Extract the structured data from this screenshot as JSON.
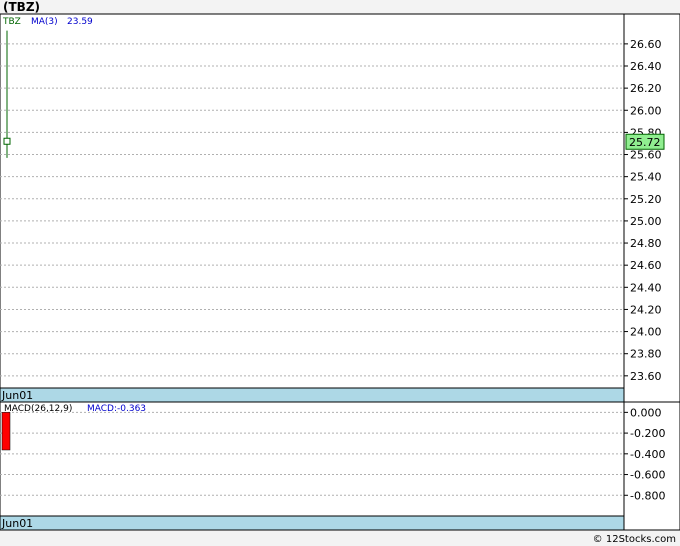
{
  "title": "(TBZ)",
  "footer": "© 12Stocks.com",
  "colors": {
    "background": "#ffffff",
    "grid": "#b0b0b0",
    "axis_band": "#add8e6",
    "price_line": "#006400",
    "last_price_box": "#90ee90",
    "macd_bar": "#ff0000",
    "ma_legend": "#0000cd"
  },
  "chart_data": [
    {
      "type": "line",
      "legend": {
        "ticker": "TBZ",
        "ma_label": "MA(3)",
        "ma_value": "23.59"
      },
      "x": [
        "Jun01"
      ],
      "xlabel_band": "Jun01",
      "yticks": [
        "26.60",
        "26.40",
        "26.20",
        "26.00",
        "25.80",
        "25.60",
        "25.40",
        "25.20",
        "25.00",
        "24.80",
        "24.60",
        "24.40",
        "24.20",
        "24.00",
        "23.80",
        "23.60"
      ],
      "ylim": [
        23.49,
        26.87
      ],
      "series": [
        {
          "name": "TBZ",
          "high": 26.72,
          "low": 25.57,
          "open": 25.72,
          "close": 25.72
        }
      ],
      "last_price": "25.72",
      "grid": true
    },
    {
      "type": "bar",
      "legend": {
        "name": "MACD(26,12,9)",
        "value_label": "MACD:-0.363"
      },
      "x": [
        "Jun01"
      ],
      "xlabel_band": "Jun01",
      "yticks": [
        "0.000",
        "-0.200",
        "-0.400",
        "-0.600",
        "-0.800"
      ],
      "ylim": [
        -1.0,
        0.1
      ],
      "values": [
        -0.363
      ],
      "grid": true
    }
  ]
}
